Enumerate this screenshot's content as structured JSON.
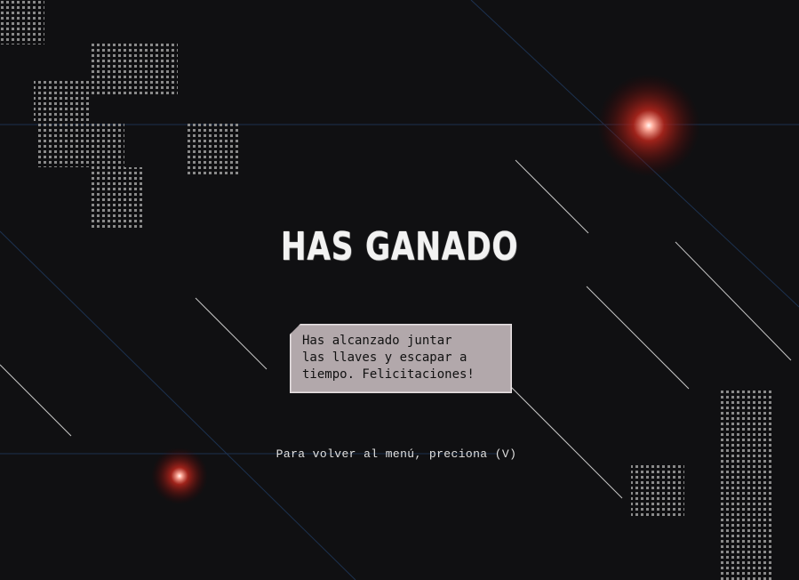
{
  "screen": {
    "title": "HAS GANADO",
    "message": "Has alcanzado juntar\nlas llaves y escapar a\ntiempo. Felicitaciones!",
    "hint": "Para volver al menú, preciona (V)"
  },
  "colors": {
    "background": "#101012",
    "glow": "#c8261e",
    "bubble": "#b2a8ab",
    "title": "#f2f2f2"
  }
}
